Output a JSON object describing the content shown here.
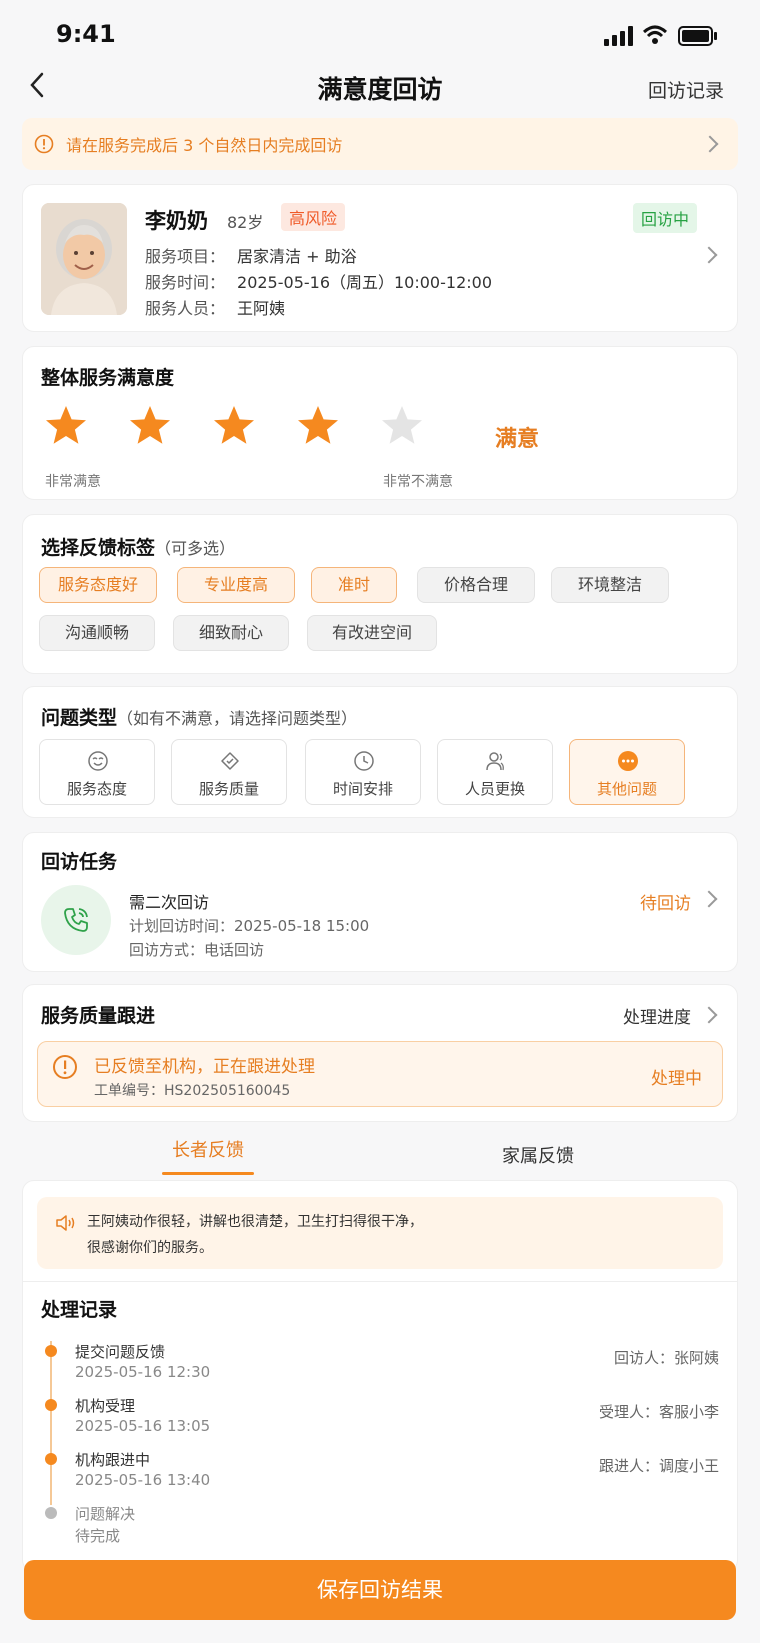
{
  "status_bar": {
    "time": "9:41"
  },
  "nav": {
    "title": "满意度回访",
    "right_link": "回访记录"
  },
  "notice": {
    "text": "请在服务完成后 3 个自然日内完成回访"
  },
  "patient": {
    "name": "李奶奶",
    "age": "82岁",
    "risk": "高风险",
    "status": "回访中",
    "service_item_label": "服务项目：",
    "service_item": "居家清洁 + 助浴",
    "service_time_label": "服务时间：",
    "service_time": "2025-05-16（周五）10:00-12:00",
    "staff_label": "服务人员：",
    "staff": "王阿姨"
  },
  "satisfaction": {
    "title": "整体服务满意度",
    "rating": 4,
    "max_rating": 5,
    "rating_label": "满意",
    "left_label": "非常满意",
    "right_label": "非常不满意"
  },
  "feedback_tags": {
    "title": "选择反馈标签",
    "subtitle": "（可多选）",
    "tags": [
      {
        "label": "服务态度好",
        "selected": true
      },
      {
        "label": "专业度高",
        "selected": true
      },
      {
        "label": "准时",
        "selected": true
      },
      {
        "label": "价格合理",
        "selected": false
      },
      {
        "label": "环境整洁",
        "selected": false
      },
      {
        "label": "沟通顺畅",
        "selected": false
      },
      {
        "label": "细致耐心",
        "selected": false
      },
      {
        "label": "有改进空间",
        "selected": false
      }
    ]
  },
  "issue_types": {
    "title": "问题类型",
    "subtitle": "（如有不满意，请选择问题类型）",
    "items": [
      {
        "label": "服务态度",
        "icon": "smile-icon",
        "selected": false
      },
      {
        "label": "服务质量",
        "icon": "quality-tag-icon",
        "selected": false
      },
      {
        "label": "时间安排",
        "icon": "clock-icon",
        "selected": false
      },
      {
        "label": "人员更换",
        "icon": "users-icon",
        "selected": false
      },
      {
        "label": "其他问题",
        "icon": "more-dots-icon",
        "selected": true
      }
    ]
  },
  "followup_task": {
    "title": "回访任务",
    "task_name": "需二次回访",
    "plan_time": "计划回访时间：2025-05-18 15:00",
    "method": "回访方式：电话回访",
    "status": "待回访",
    "icon": "phone-icon"
  },
  "quality_followup": {
    "title": "服务质量跟进",
    "progress_link": "处理进度",
    "alert_title": "已反馈至机构，正在跟进处理",
    "ticket": "工单编号：HS202505160045",
    "status": "处理中"
  },
  "tabs": [
    {
      "label": "长者反馈",
      "active": true
    },
    {
      "label": "家属反馈",
      "active": false
    }
  ],
  "feedback_quote": {
    "line1": "王阿姨动作很轻，讲解也很清楚，卫生打扫得很干净，",
    "line2": "很感谢你们的服务。"
  },
  "records": {
    "title": "处理记录",
    "items": [
      {
        "title": "提交问题反馈",
        "time": "2025-05-16 12:30",
        "person": "回访人：张阿姨",
        "done": true
      },
      {
        "title": "机构受理",
        "time": "2025-05-16 13:05",
        "person": "受理人：客服小李",
        "done": true
      },
      {
        "title": "机构跟进中",
        "time": "2025-05-16 13:40",
        "person": "跟进人：调度小王",
        "done": true
      },
      {
        "title": "问题解决",
        "time": "待完成",
        "person": "",
        "done": false
      }
    ]
  },
  "footer": {
    "save_label": "保存回访结果"
  },
  "colors": {
    "accent": "#f5891f",
    "accent_text": "#e67e22",
    "success": "#27a243",
    "risk": "#f05a28"
  }
}
